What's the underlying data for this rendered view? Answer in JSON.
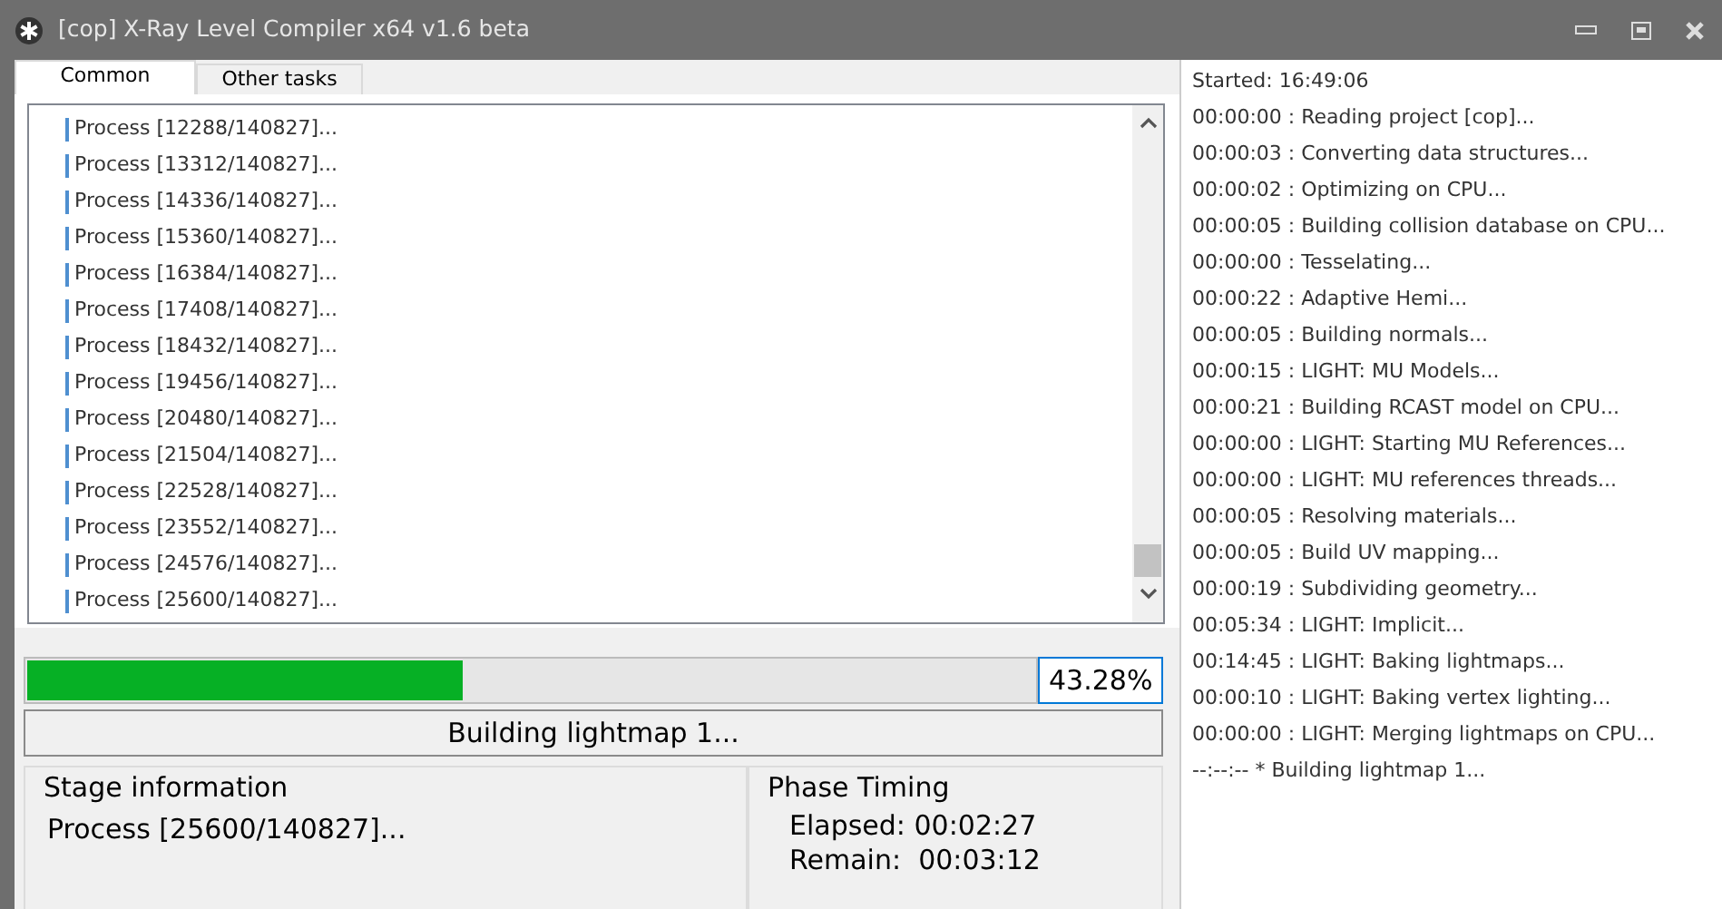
{
  "window": {
    "title": "[cop] X-Ray Level Compiler x64 v1.6 beta"
  },
  "tabs": [
    {
      "label": "Common",
      "selected": true
    },
    {
      "label": "Other tasks",
      "selected": false
    }
  ],
  "process_list": [
    "Process [12288/140827]...",
    "Process [13312/140827]...",
    "Process [14336/140827]...",
    "Process [15360/140827]...",
    "Process [16384/140827]...",
    "Process [17408/140827]...",
    "Process [18432/140827]...",
    "Process [19456/140827]...",
    "Process [20480/140827]...",
    "Process [21504/140827]...",
    "Process [22528/140827]...",
    "Process [23552/140827]...",
    "Process [24576/140827]...",
    "Process [25600/140827]..."
  ],
  "progress": {
    "level": 0.4328,
    "percent": "43.28%"
  },
  "status": "Building lightmap 1...",
  "stage_information": {
    "title": "Stage information",
    "text": "Process [25600/140827]..."
  },
  "phase_timing": {
    "title": "Phase Timing",
    "elapsed_label": "Elapsed:",
    "elapsed": "00:02:27",
    "remain_label": "Remain:",
    "remain": "00:03:12"
  },
  "log": [
    "Started: 16:49:06",
    "00:00:00 : Reading project [cop]...",
    "00:00:03 : Converting data structures...",
    "00:00:02 : Optimizing on CPU...",
    "00:00:05 : Building collision database on CPU...",
    "00:00:00 : Tesselating...",
    "00:00:22 : Adaptive Hemi...",
    "00:00:05 : Building normals...",
    "00:00:15 : LIGHT: MU Models...",
    "00:00:21 : Building RCAST model on CPU...",
    "00:00:00 : LIGHT: Starting MU References...",
    "00:00:00 : LIGHT: MU references threads...",
    "00:00:05 : Resolving materials...",
    "00:00:05 : Build UV mapping...",
    "00:00:19 : Subdividing geometry...",
    "00:05:34 : LIGHT: Implicit...",
    "00:14:45 : LIGHT: Baking lightmaps...",
    "00:00:10 : LIGHT: Baking vertex lighting...",
    "00:00:00 : LIGHT: Merging lightmaps on CPU...",
    "--:--:-- * Building lightmap 1..."
  ]
}
